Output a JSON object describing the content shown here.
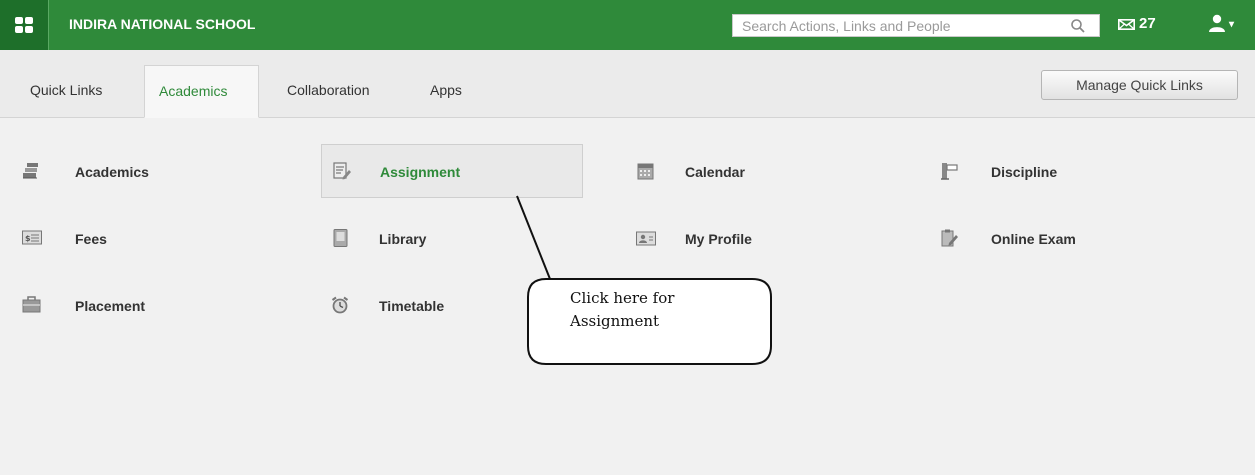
{
  "header": {
    "school_name": "INDIRA NATIONAL SCHOOL",
    "search_placeholder": "Search Actions, Links and People",
    "message_count": "27",
    "icons": {
      "apps": "apps-grid-icon",
      "search": "search-icon",
      "mail": "envelope-icon",
      "user": "user-icon"
    }
  },
  "tabs": [
    {
      "label": "Quick Links"
    },
    {
      "label": "Academics",
      "active": true
    },
    {
      "label": "Collaboration"
    },
    {
      "label": "Apps"
    }
  ],
  "manage_button": {
    "label": "Manage Quick Links"
  },
  "links": [
    {
      "label": "Academics",
      "icon": "books-icon"
    },
    {
      "label": "Assignment",
      "icon": "assignment-icon",
      "highlighted": true
    },
    {
      "label": "Calendar",
      "icon": "calendar-icon"
    },
    {
      "label": "Discipline",
      "icon": "discipline-icon"
    },
    {
      "label": "Fees",
      "icon": "fees-icon"
    },
    {
      "label": "Library",
      "icon": "library-icon"
    },
    {
      "label": "My Profile",
      "icon": "profile-card-icon"
    },
    {
      "label": "Online Exam",
      "icon": "online-exam-icon"
    },
    {
      "label": "Placement",
      "icon": "briefcase-icon"
    },
    {
      "label": "Timetable",
      "icon": "alarm-clock-icon"
    }
  ],
  "annotation": {
    "line1": "Click here for",
    "line2": "Assignment"
  },
  "colors": {
    "brand_green": "#2f8a3a",
    "brand_green_dark": "#1e6f2a",
    "page_background": "#f1f1f1"
  }
}
